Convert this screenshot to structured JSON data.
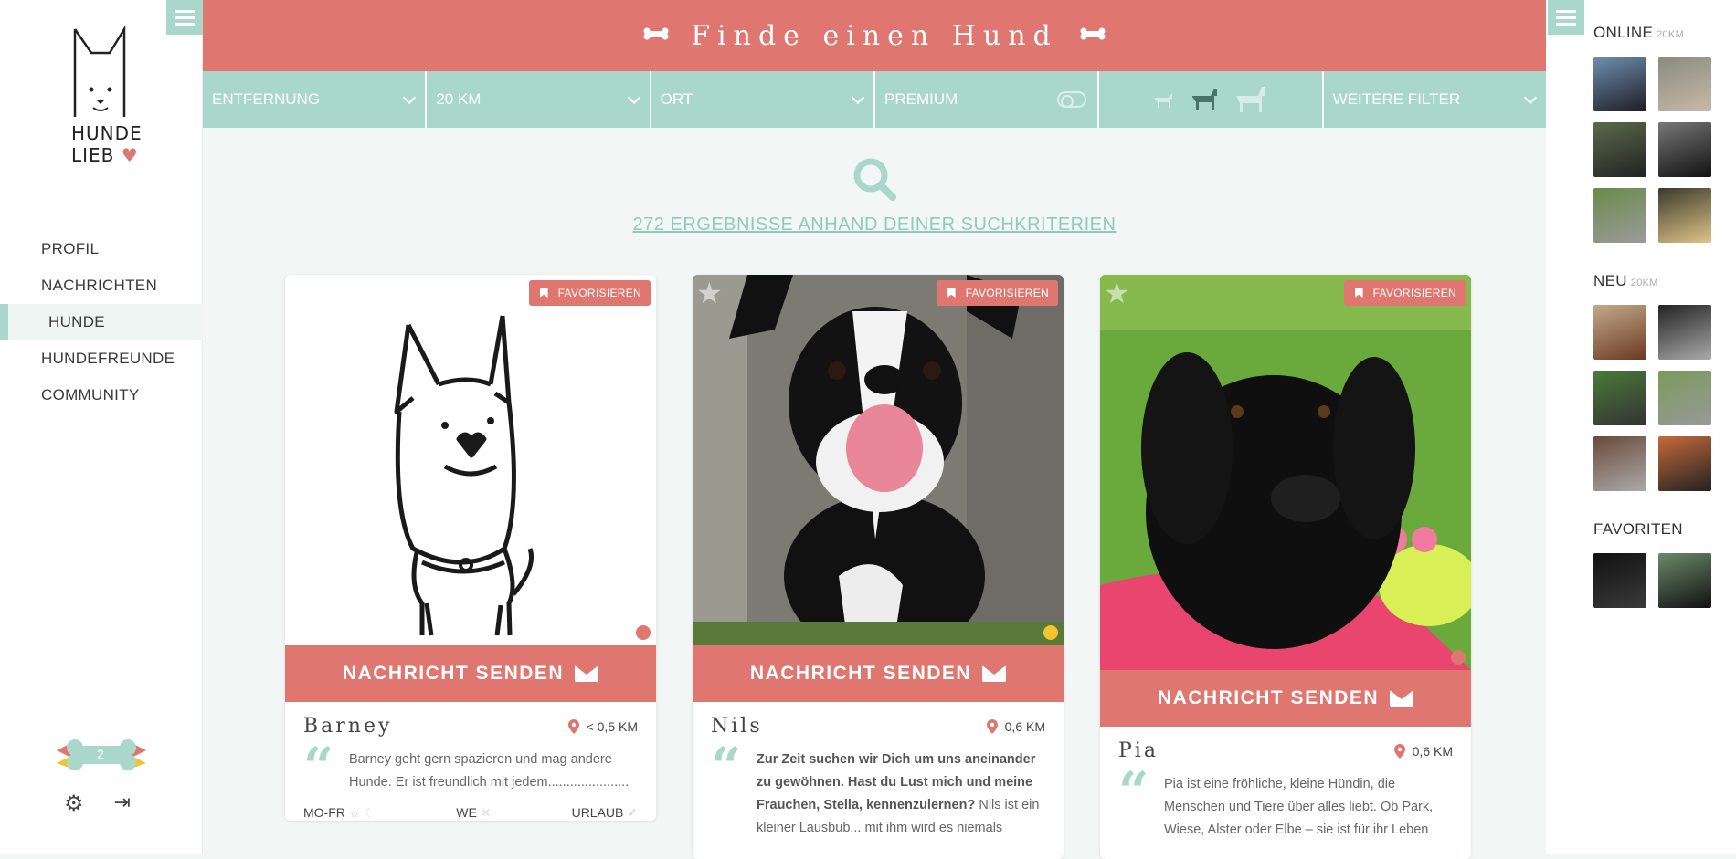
{
  "logo": {
    "line1": "HUNDE",
    "line2": "LIEB"
  },
  "nav": [
    {
      "label": "PROFIL"
    },
    {
      "label": "NACHRICHTEN"
    },
    {
      "label": "HUNDE"
    },
    {
      "label": "HUNDEFREUNDE"
    },
    {
      "label": "COMMUNITY"
    }
  ],
  "badge": {
    "count": "2"
  },
  "header": {
    "title": "Finde einen Hund"
  },
  "filters": {
    "distance": "ENTFERNUNG",
    "radius": "20 KM",
    "place": "ORT",
    "premium": "PREMIUM",
    "more": "WEITERE FILTER"
  },
  "search": {
    "results_text": "272 ERGEBNISSE ANHAND DEINER SUCHKRITERIEN"
  },
  "cards": [
    {
      "fav_label": "FAVORISIEREN",
      "send_label": "NACHRICHT SENDEN",
      "name": "Barney",
      "distance": "< 0,5 KM",
      "text": "Barney geht gern spazieren und mag andere Hunde. Er ist freundlich mit jedem......................",
      "avail": {
        "weekdays": "MO-FR",
        "weekend": "WE",
        "vacation": "URLAUB"
      },
      "status_color": "#e07670"
    },
    {
      "fav_label": "FAVORISIEREN",
      "send_label": "NACHRICHT SENDEN",
      "name": "Nils",
      "distance": "0,6 KM",
      "text_bold": "Zur Zeit suchen wir Dich um uns aneinander zu gewöhnen. Hast du Lust mich und meine Frauchen, Stella, kennenzulernen?",
      "text": " Nils ist ein kleiner Lausbub... mit ihm wird es niemals",
      "status_color": "#f4c430"
    },
    {
      "fav_label": "FAVORISIEREN",
      "send_label": "NACHRICHT SENDEN",
      "name": "Pia",
      "distance": "0,6 KM",
      "text": "Pia ist eine fröhliche, kleine Hündin, die Menschen und Tiere über alles liebt. Ob Park, Wiese, Alster oder Elbe – sie ist für ihr Leben",
      "status_color": "#e07670"
    }
  ],
  "sidebar": {
    "online": {
      "title": "ONLINE",
      "sub": "20KM"
    },
    "new": {
      "title": "NEU",
      "sub": "20KM"
    },
    "favorites": {
      "title": "FAVORITEN"
    }
  },
  "colors": {
    "accent": "#e07670",
    "mint": "#a9d8cb",
    "background": "#f2f7f5"
  }
}
